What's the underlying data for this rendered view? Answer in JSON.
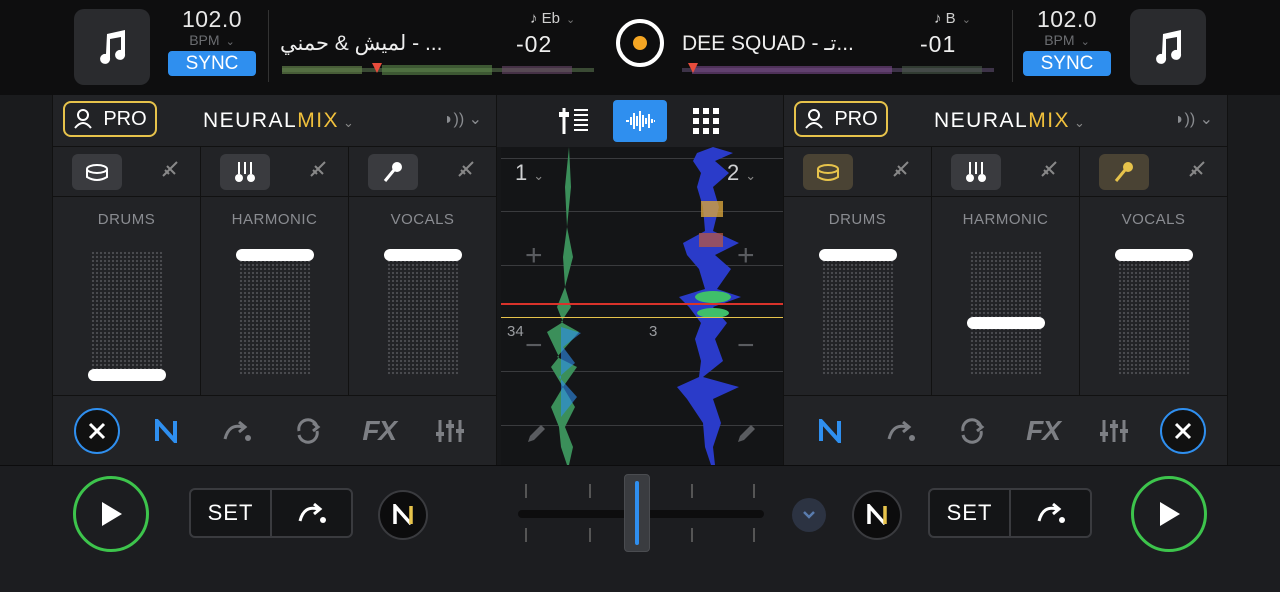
{
  "deckA": {
    "bpm": "102.0",
    "bpm_label": "BPM",
    "sync_label": "SYNC",
    "key_label": "♪ Eb",
    "title": "لميش & حمني - ...",
    "time": "-02",
    "pro_label": "PRO",
    "neural_label": "NEURAL",
    "mix_label": "MIX",
    "stems": [
      "DRUMS",
      "HARMONIC",
      "VOCALS"
    ],
    "stem_levels": [
      0.05,
      1.0,
      1.0
    ],
    "fx_label": "FX",
    "set_label": "SET",
    "deck_num": "1",
    "beat": "34"
  },
  "deckB": {
    "bpm": "102.0",
    "bpm_label": "BPM",
    "sync_label": "SYNC",
    "key_label": "♪ B",
    "title": "DEE SQUAD - تـ...",
    "time": "-01",
    "pro_label": "PRO",
    "neural_label": "NEURAL",
    "mix_label": "MIX",
    "stems": [
      "DRUMS",
      "HARMONIC",
      "VOCALS"
    ],
    "stem_levels": [
      1.0,
      0.45,
      1.0
    ],
    "fx_label": "FX",
    "set_label": "SET",
    "deck_num": "2",
    "beat": "3"
  },
  "colors": {
    "accent": "#2f8fef",
    "pro_gold": "#e7c34b",
    "play_green": "#3dc44c"
  },
  "icons": [
    "music-note-icon",
    "record-icon",
    "speaker-icon",
    "drums-icon",
    "harmonic-icon",
    "mic-icon",
    "mute-icon",
    "close-icon",
    "neural-n-icon",
    "cue-jump-icon",
    "loop-icon",
    "fx-icon",
    "eq-sliders-icon",
    "play-icon",
    "mixer-icon",
    "waveform-icon",
    "grid-icon",
    "pencil-icon"
  ]
}
